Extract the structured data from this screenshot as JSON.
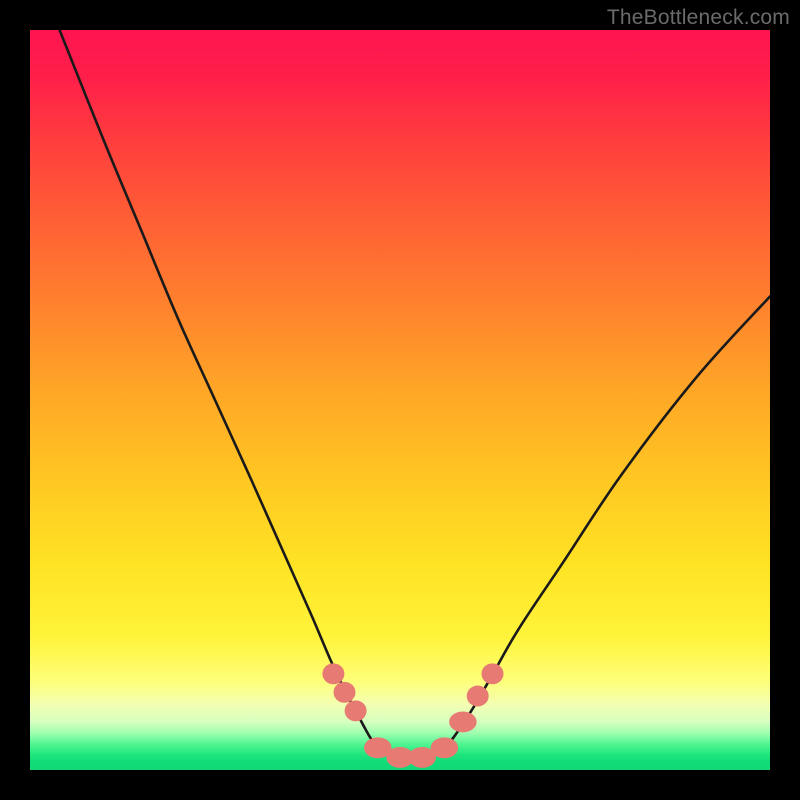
{
  "watermark": "TheBottleneck.com",
  "colors": {
    "frame": "#000000",
    "curve_stroke": "#1a1a1a",
    "marker_fill": "#e77a72",
    "gradient_top": "#ff1450",
    "gradient_bottom": "#12d878"
  },
  "chart_data": {
    "type": "line",
    "title": "",
    "xlabel": "",
    "ylabel": "",
    "xlim": [
      0,
      100
    ],
    "ylim": [
      0,
      100
    ],
    "note": "Axes unlabeled; values are relative proportions of the plotting area (0 = bottom/left, 100 = top/right). Curve is a V-shape reaching ~0 near x≈47–57.",
    "series": [
      {
        "name": "bottleneck-curve",
        "x": [
          4,
          10,
          15,
          20,
          25,
          30,
          34,
          38,
          41,
          44,
          47,
          50,
          53,
          56,
          59,
          62,
          66,
          72,
          80,
          90,
          100
        ],
        "values": [
          100,
          85,
          73,
          61,
          50,
          39,
          30,
          21,
          14,
          8,
          3,
          1.5,
          1.5,
          3,
          7,
          12,
          19,
          28,
          40,
          53,
          64
        ]
      },
      {
        "name": "markers",
        "x": [
          41.0,
          42.5,
          44.0,
          47.0,
          50.0,
          53.0,
          56.0,
          58.5,
          60.5,
          62.5
        ],
        "values": [
          13.0,
          10.5,
          8.0,
          3.0,
          1.7,
          1.7,
          3.0,
          6.5,
          10.0,
          13.0
        ]
      }
    ]
  }
}
